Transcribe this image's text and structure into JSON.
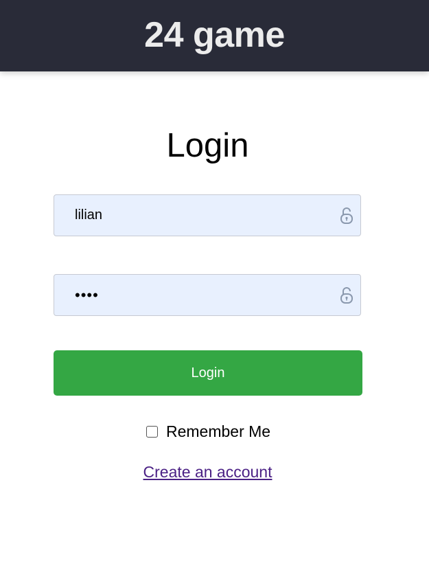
{
  "header": {
    "title": "24 game"
  },
  "page": {
    "title": "Login"
  },
  "username": {
    "value": "lilian",
    "icon": "lock-icon"
  },
  "password": {
    "masked_value": "••••",
    "icon": "lock-icon"
  },
  "login_button": {
    "label": "Login"
  },
  "remember_me": {
    "label": "Remember Me",
    "checked": false
  },
  "create_account": {
    "label": "Create an account"
  },
  "colors": {
    "header_bg": "#292b38",
    "input_bg": "#e8f0fe",
    "button_bg": "#34a744",
    "link": "#4b2185"
  }
}
